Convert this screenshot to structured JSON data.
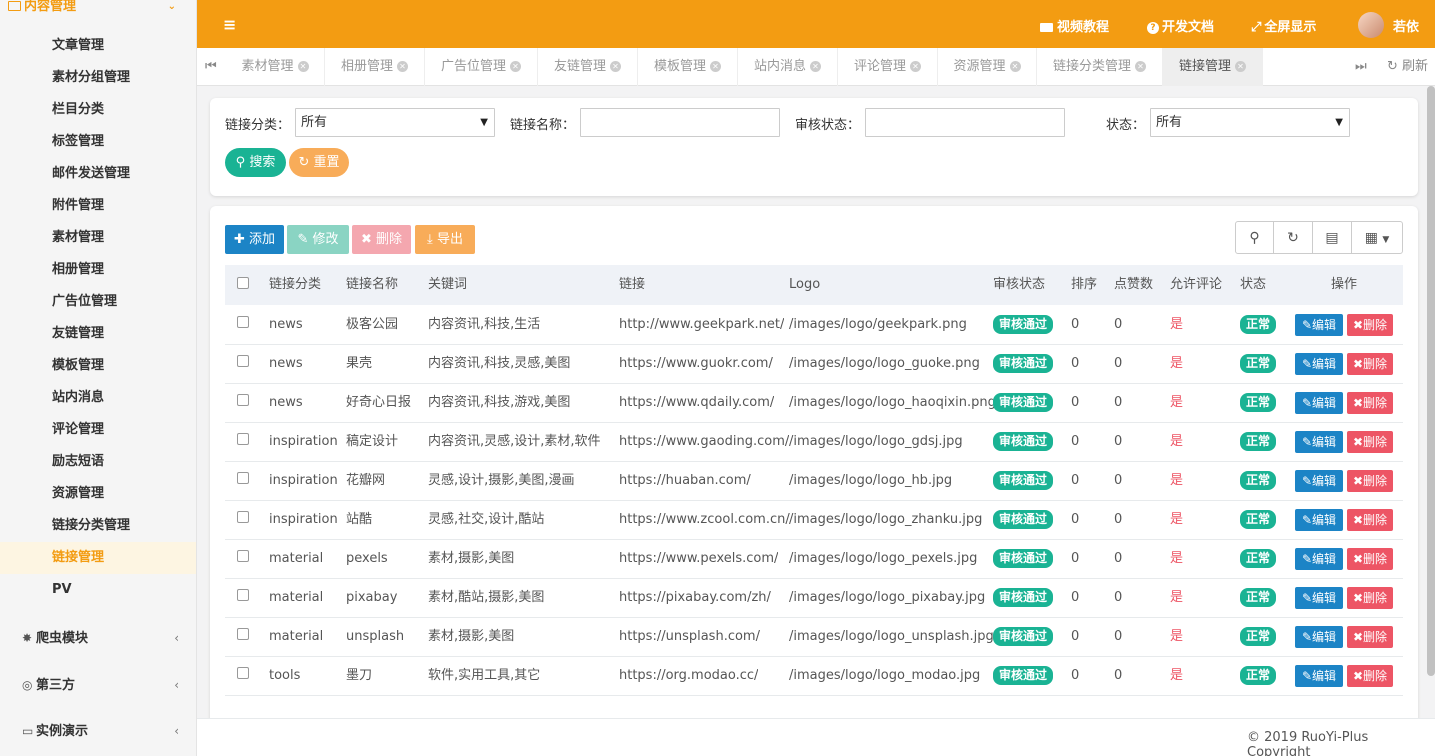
{
  "sidebar": {
    "section_title": "内容管理",
    "section_icon": "id-card-icon",
    "items": [
      {
        "label": "文章管理"
      },
      {
        "label": "素材分组管理"
      },
      {
        "label": "栏目分类"
      },
      {
        "label": "标签管理"
      },
      {
        "label": "邮件发送管理"
      },
      {
        "label": "附件管理"
      },
      {
        "label": "素材管理"
      },
      {
        "label": "相册管理"
      },
      {
        "label": "广告位管理"
      },
      {
        "label": "友链管理"
      },
      {
        "label": "模板管理"
      },
      {
        "label": "站内消息"
      },
      {
        "label": "评论管理"
      },
      {
        "label": "励志短语"
      },
      {
        "label": "资源管理"
      },
      {
        "label": "链接分类管理"
      },
      {
        "label": "链接管理",
        "active": true
      },
      {
        "label": "PV"
      }
    ],
    "groups": [
      {
        "label": "爬虫模块",
        "icon": "bug-icon"
      },
      {
        "label": "第三方",
        "icon": "globe-icon"
      },
      {
        "label": "实例演示",
        "icon": "desktop-icon"
      }
    ]
  },
  "topbar": {
    "video_label": "视频教程",
    "docs_label": "开发文档",
    "fullscreen_label": "全屏显示",
    "user_name": "若依",
    "bg_color": "#f39c12"
  },
  "tabs": {
    "items": [
      "素材管理",
      "相册管理",
      "广告位管理",
      "友链管理",
      "模板管理",
      "站内消息",
      "评论管理",
      "资源管理",
      "链接分类管理",
      "链接管理"
    ],
    "active_index": 9,
    "refresh_label": "刷新"
  },
  "search": {
    "category_label": "链接分类：",
    "category_value": "所有",
    "name_label": "链接名称：",
    "name_value": "",
    "audit_label": "审核状态：",
    "audit_value": "",
    "status_label": "状态：",
    "status_value": "所有",
    "search_button": "搜索",
    "reset_button": "重置"
  },
  "toolbar": {
    "add_label": "添加",
    "edit_label": "修改",
    "delete_label": "删除",
    "export_label": "导出"
  },
  "table": {
    "columns": [
      "链接分类",
      "链接名称",
      "关键词",
      "链接",
      "Logo",
      "审核状态",
      "排序",
      "点赞数",
      "允许评论",
      "状态",
      "操作"
    ],
    "edit_label": "编辑",
    "delete_label": "删除",
    "rows": [
      {
        "category": "news",
        "name": "极客公园",
        "keywords": "内容资讯,科技,生活",
        "url": "http://www.geekpark.net/",
        "logo": "/images/logo/geekpark.png",
        "audit": "审核通过",
        "sort": "0",
        "likes": "0",
        "comment": "是",
        "status": "正常"
      },
      {
        "category": "news",
        "name": "果壳",
        "keywords": "内容资讯,科技,灵感,美图",
        "url": "https://www.guokr.com/",
        "logo": "/images/logo/logo_guoke.png",
        "audit": "审核通过",
        "sort": "0",
        "likes": "0",
        "comment": "是",
        "status": "正常"
      },
      {
        "category": "news",
        "name": "好奇心日报",
        "keywords": "内容资讯,科技,游戏,美图",
        "url": "https://www.qdaily.com/",
        "logo": "/images/logo/logo_haoqixin.png",
        "audit": "审核通过",
        "sort": "0",
        "likes": "0",
        "comment": "是",
        "status": "正常"
      },
      {
        "category": "inspiration",
        "name": "稿定设计",
        "keywords": "内容资讯,灵感,设计,素材,软件",
        "url": "https://www.gaoding.com/",
        "logo": "/images/logo/logo_gdsj.jpg",
        "audit": "审核通过",
        "sort": "0",
        "likes": "0",
        "comment": "是",
        "status": "正常"
      },
      {
        "category": "inspiration",
        "name": "花瓣网",
        "keywords": "灵感,设计,摄影,美图,漫画",
        "url": "https://huaban.com/",
        "logo": "/images/logo/logo_hb.jpg",
        "audit": "审核通过",
        "sort": "0",
        "likes": "0",
        "comment": "是",
        "status": "正常"
      },
      {
        "category": "inspiration",
        "name": "站酷",
        "keywords": "灵感,社交,设计,酷站",
        "url": "https://www.zcool.com.cn/",
        "logo": "/images/logo/logo_zhanku.jpg",
        "audit": "审核通过",
        "sort": "0",
        "likes": "0",
        "comment": "是",
        "status": "正常"
      },
      {
        "category": "material",
        "name": "pexels",
        "keywords": "素材,摄影,美图",
        "url": "https://www.pexels.com/",
        "logo": "/images/logo/logo_pexels.jpg",
        "audit": "审核通过",
        "sort": "0",
        "likes": "0",
        "comment": "是",
        "status": "正常"
      },
      {
        "category": "material",
        "name": "pixabay",
        "keywords": "素材,酷站,摄影,美图",
        "url": "https://pixabay.com/zh/",
        "logo": "/images/logo/logo_pixabay.jpg",
        "audit": "审核通过",
        "sort": "0",
        "likes": "0",
        "comment": "是",
        "status": "正常"
      },
      {
        "category": "material",
        "name": "unsplash",
        "keywords": "素材,摄影,美图",
        "url": "https://unsplash.com/",
        "logo": "/images/logo/logo_unsplash.jpg",
        "audit": "审核通过",
        "sort": "0",
        "likes": "0",
        "comment": "是",
        "status": "正常"
      },
      {
        "category": "tools",
        "name": "墨刀",
        "keywords": "软件,实用工具,其它",
        "url": "https://org.modao.cc/",
        "logo": "/images/logo/logo_modao.jpg",
        "audit": "审核通过",
        "sort": "0",
        "likes": "0",
        "comment": "是",
        "status": "正常"
      }
    ]
  },
  "footer": {
    "copyright": "© 2019 RuoYi-Plus Copyright"
  },
  "colors": {
    "primary": "#1c84c6",
    "success": "#1ab394",
    "danger": "#ed5565",
    "warning": "#f8ac59",
    "accent": "#f39c12"
  }
}
